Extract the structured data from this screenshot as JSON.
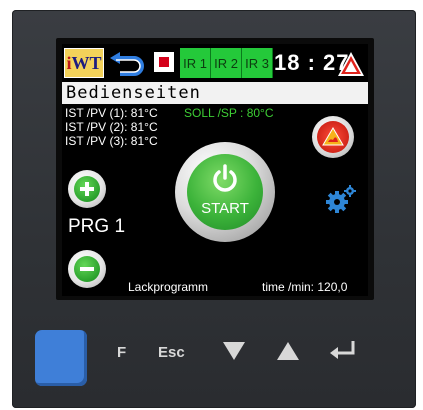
{
  "status_bar": {
    "logo_text_a": "i",
    "logo_text_b": "WT",
    "back_icon": "return-arrow-icon",
    "stop_icon": "stop-icon",
    "ir_channels": [
      "IR 1",
      "IR 2",
      "IR 3"
    ],
    "time": "18 : 27",
    "warning_icon": "warning-triangle-icon"
  },
  "page_title": "Bedienseiten",
  "readings": {
    "ist1": "IST /PV (1): 81°C",
    "ist2": "IST /PV (2): 81°C",
    "ist3": "IST /PV (3): 81°C",
    "soll": "SOLL /SP : 80°C"
  },
  "controls": {
    "program_label": "PRG  1",
    "start_label": "START",
    "alarm_icon": "alarm-icon",
    "settings_icon": "gear-icon"
  },
  "footer": {
    "program_name": "Lackprogramm",
    "time_label": "time /min:  120,0"
  },
  "keys": {
    "f": "F",
    "esc": "Esc",
    "down_icon": "down-triangle-icon",
    "up_icon": "up-triangle-icon",
    "enter_icon": "enter-icon"
  },
  "colors": {
    "ir_green": "#24c93a",
    "soll_green": "#3dcc34",
    "blue_key": "#3f7fd8",
    "alarm_red": "#d4001a"
  }
}
